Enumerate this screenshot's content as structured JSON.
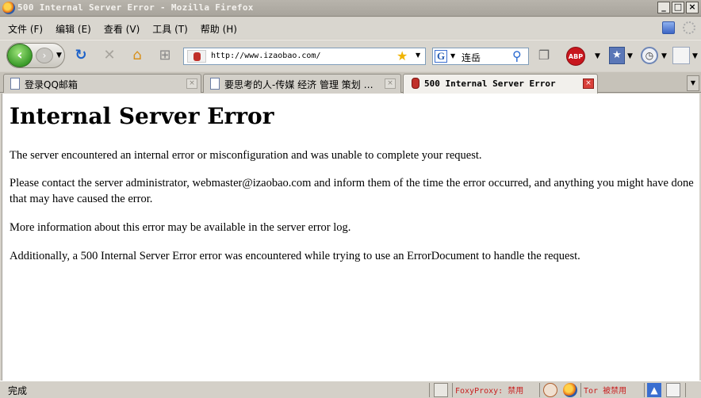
{
  "window": {
    "title": "500 Internal Server Error - Mozilla Firefox",
    "controls": [
      "_",
      "□",
      "×"
    ]
  },
  "menu": {
    "items": [
      "文件 (F)",
      "编辑 (E)",
      "查看 (V)",
      "工具 (T)",
      "帮助 (H)"
    ]
  },
  "navbar": {
    "url": "http://www.izaobao.com/",
    "search_value": "连岳",
    "search_engine_letter": "G",
    "abp_label": "ABP"
  },
  "tabs": [
    {
      "label": "登录QQ邮箱",
      "active": false
    },
    {
      "label": "要思考的人-传媒 经济 管理 策划 …",
      "active": false
    },
    {
      "label": "500 Internal Server Error",
      "active": true
    }
  ],
  "page": {
    "heading": "Internal Server Error",
    "p1": "The server encountered an internal error or misconfiguration and was unable to complete your request.",
    "p2": "Please contact the server administrator, webmaster@izaobao.com and inform them of the time the error occurred, and anything you might have done that may have caused the error.",
    "p3": "More information about this error may be available in the server error log.",
    "p4": "Additionally, a 500 Internal Server Error error was encountered while trying to use an ErrorDocument to handle the request."
  },
  "status": {
    "text": "完成",
    "foxyproxy": "FoxyProxy: 禁用",
    "tor": "Tor 被禁用"
  }
}
